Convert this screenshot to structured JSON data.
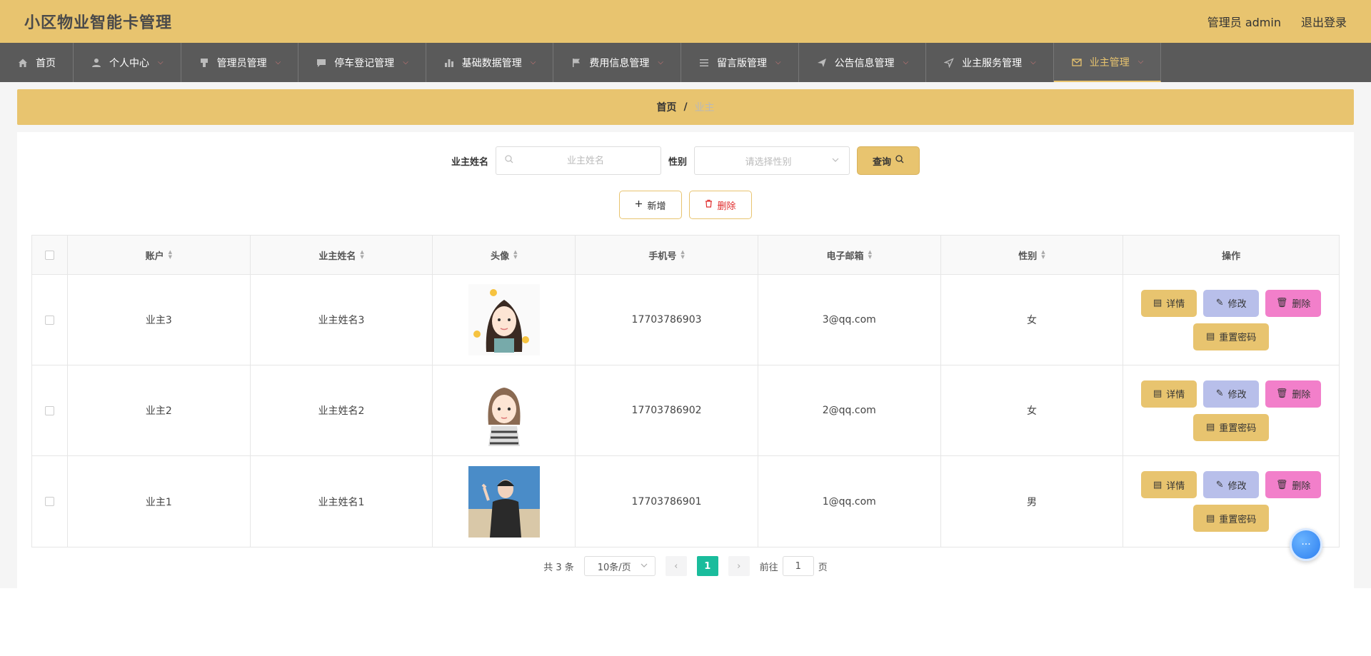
{
  "header": {
    "title": "小区物业智能卡管理",
    "user_label": "管理员 admin",
    "logout_label": "退出登录"
  },
  "nav": {
    "items": [
      {
        "label": "首页",
        "icon": "home-icon"
      },
      {
        "label": "个人中心",
        "icon": "user-icon"
      },
      {
        "label": "管理员管理",
        "icon": "admin-icon"
      },
      {
        "label": "停车登记管理",
        "icon": "chat-icon"
      },
      {
        "label": "基础数据管理",
        "icon": "bar-chart-icon"
      },
      {
        "label": "费用信息管理",
        "icon": "flag-icon"
      },
      {
        "label": "留言版管理",
        "icon": "list-icon"
      },
      {
        "label": "公告信息管理",
        "icon": "send-icon"
      },
      {
        "label": "业主服务管理",
        "icon": "navigation-icon"
      },
      {
        "label": "业主管理",
        "icon": "mail-icon"
      }
    ]
  },
  "breadcrumb": {
    "home": "首页",
    "sep": "/",
    "current": "业主"
  },
  "search": {
    "name_label": "业主姓名",
    "name_placeholder": "业主姓名",
    "gender_label": "性别",
    "gender_placeholder": "请选择性别",
    "query_label": "查询"
  },
  "actions": {
    "add_label": "新增",
    "delete_label": "删除"
  },
  "table": {
    "headers": [
      "账户",
      "业主姓名",
      "头像",
      "手机号",
      "电子邮箱",
      "性别",
      "操作"
    ],
    "rows": [
      {
        "account": "业主3",
        "name": "业主姓名3",
        "phone": "17703786903",
        "email": "3@qq.com",
        "gender": "女"
      },
      {
        "account": "业主2",
        "name": "业主姓名2",
        "phone": "17703786902",
        "email": "2@qq.com",
        "gender": "女"
      },
      {
        "account": "业主1",
        "name": "业主姓名1",
        "phone": "17703786901",
        "email": "1@qq.com",
        "gender": "男"
      }
    ],
    "op_labels": {
      "detail": "详情",
      "edit": "修改",
      "delete": "删除",
      "reset": "重置密码"
    }
  },
  "pagination": {
    "total": "共 3 条",
    "page_size": "10条/页",
    "current_page": "1",
    "goto_prefix": "前往",
    "goto_value": "1",
    "goto_suffix": "页"
  },
  "colors": {
    "accent": "#e8c46f",
    "nav_bg": "#5a5a5a",
    "edit_btn": "#b8bfea",
    "delete_btn": "#f27fca",
    "page_active": "#1abc9c"
  }
}
